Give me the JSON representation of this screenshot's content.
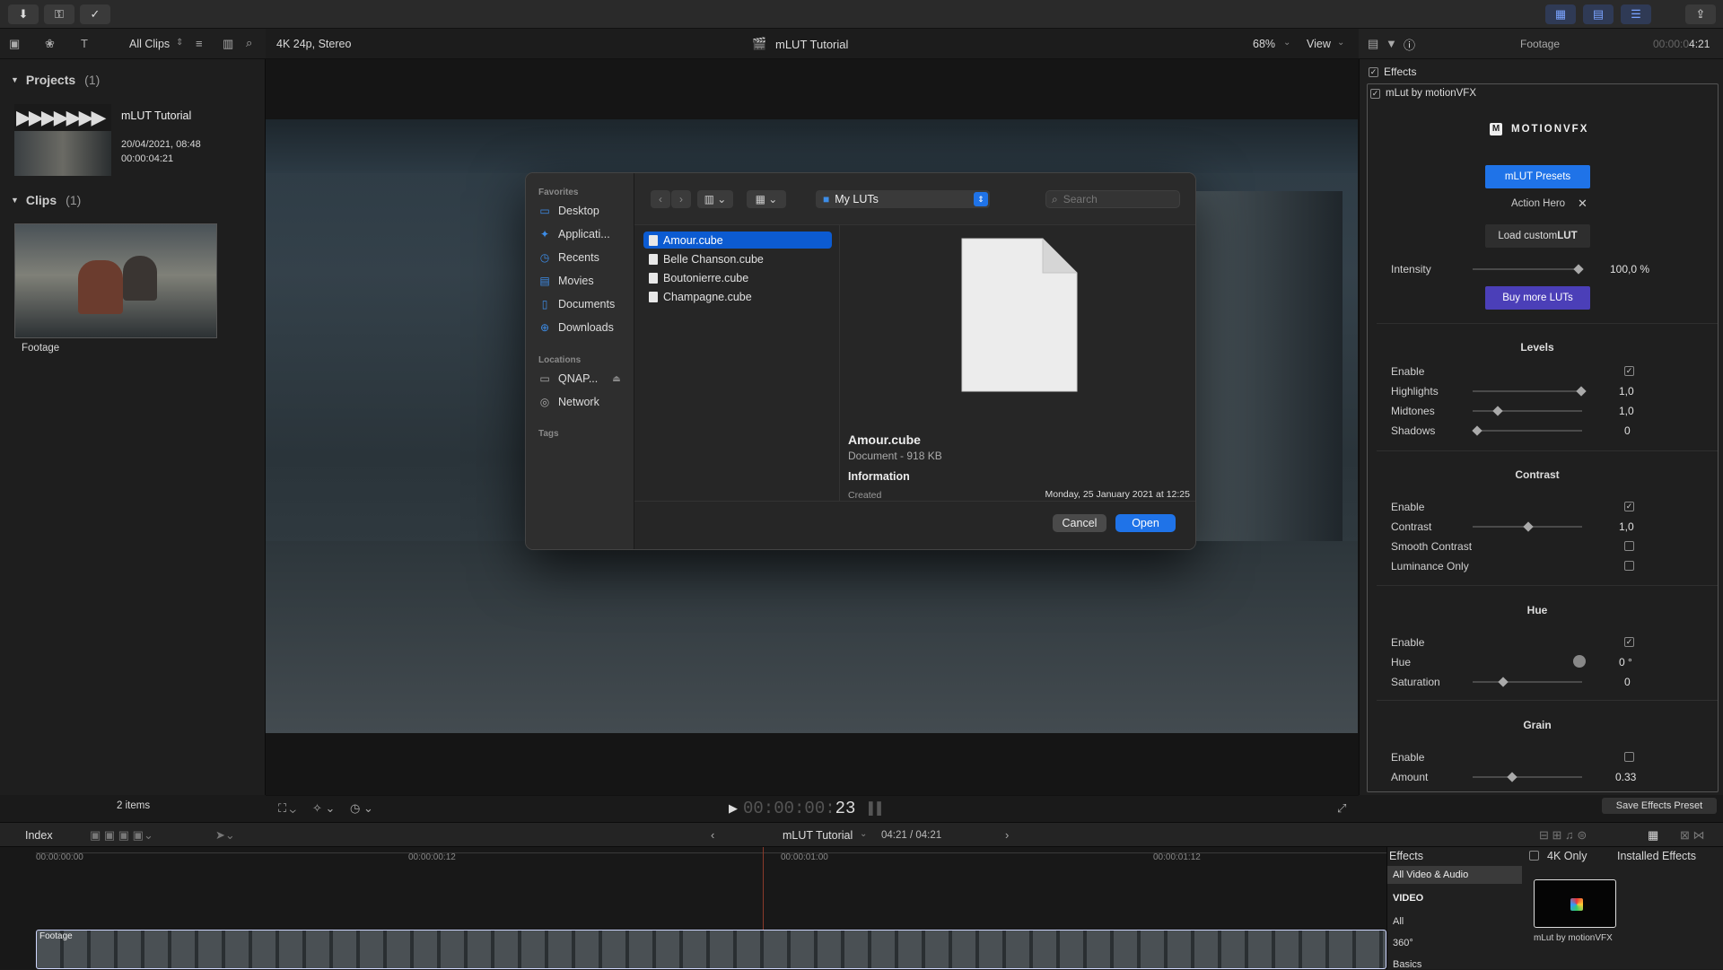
{
  "toolbar": {
    "import_icon": "download-arrow-icon",
    "keyword_icon": "key-icon",
    "check_icon": "checkmark-circle-icon"
  },
  "browser": {
    "filter_label": "All Clips",
    "projects_label": "Projects",
    "projects_count": "(1)",
    "project_name": "mLUT Tutorial",
    "project_date": "20/04/2021, 08:48",
    "project_duration": "00:00:04:21",
    "clips_label": "Clips",
    "clips_count": "(1)",
    "clip_name": "Footage",
    "items_count": "2 items"
  },
  "viewer": {
    "format": "4K 24p, Stereo",
    "title": "mLUT Tutorial",
    "zoom": "68%",
    "view_label": "View",
    "timecode_dim": "00:00:00:",
    "timecode_frame": "23"
  },
  "inspector": {
    "tab_label": "Footage",
    "duration_dim": "00:00:0",
    "duration": "4:21",
    "effects_label": "Effects",
    "plugin_label": "mLut by motionVFX",
    "brand": "MOTIONVFX",
    "presets_button": "mLUT Presets",
    "preset_selected": "Action Hero",
    "load_custom": "Load custom ",
    "load_custom_bold": "LUT",
    "intensity_label": "Intensity",
    "intensity_value": "100,0",
    "intensity_unit": "%",
    "intensity_fraction": 0.97,
    "buy_button": "Buy more LUTs",
    "levels_title": "Levels",
    "levels_enable": "Enable",
    "highlights_label": "Highlights",
    "highlights_value": "1,0",
    "midtones_label": "Midtones",
    "midtones_value": "1,0",
    "shadows_label": "Shadows",
    "shadows_value": "0",
    "contrast_title": "Contrast",
    "contrast_enable": "Enable",
    "contrast_label": "Contrast",
    "contrast_value": "1,0",
    "smooth_label": "Smooth Contrast",
    "lum_label": "Luminance Only",
    "hue_title": "Hue",
    "hue_enable": "Enable",
    "hue_label": "Hue",
    "hue_value": "0",
    "hue_unit": "°",
    "sat_label": "Saturation",
    "sat_value": "0",
    "grain_title": "Grain",
    "grain_enable": "Enable",
    "amount_label": "Amount",
    "amount_value": "0.33",
    "save_preset": "Save Effects Preset"
  },
  "dialog": {
    "favorites_header": "Favorites",
    "favorites": [
      {
        "label": "Desktop",
        "icon": "desktop-icon"
      },
      {
        "label": "Applicati...",
        "icon": "applications-icon"
      },
      {
        "label": "Recents",
        "icon": "clock-icon"
      },
      {
        "label": "Movies",
        "icon": "film-icon"
      },
      {
        "label": "Documents",
        "icon": "document-icon"
      },
      {
        "label": "Downloads",
        "icon": "download-icon"
      }
    ],
    "locations_header": "Locations",
    "locations": [
      {
        "label": "QNAP...",
        "icon": "monitor-icon"
      },
      {
        "label": "Network",
        "icon": "globe-icon"
      }
    ],
    "tags_header": "Tags",
    "folder": "My LUTs",
    "search_placeholder": "Search",
    "files": [
      "Amour.cube",
      "Belle Chanson.cube",
      "Boutonierre.cube",
      "Champagne.cube"
    ],
    "selected_name": "Amour.cube",
    "selected_kind": "Document - 918 KB",
    "info_header": "Information",
    "created_label": "Created",
    "created_value": "Monday, 25 January 2021 at 12:25",
    "cancel": "Cancel",
    "open": "Open"
  },
  "timeline": {
    "index_label": "Index",
    "project": "mLUT Tutorial",
    "position": "04:21 / 04:21",
    "ruler": [
      "00:00:00:00",
      "00:00:00:12",
      "00:00:01:00",
      "00:00:01:12"
    ],
    "clip_label": "Footage"
  },
  "effects": {
    "title": "Effects",
    "fourk_only": "4K Only",
    "installed": "Installed Effects",
    "categories": [
      "All Video & Audio",
      "VIDEO",
      "All",
      "360°",
      "Basics"
    ],
    "thumb_label": "mLut by motionVFX"
  },
  "colors": {
    "accent_blue": "#0c5bd1",
    "button_blue": "#1f73e8",
    "purple": "#4b3fb8",
    "selection_blue": "#0a84ff"
  }
}
